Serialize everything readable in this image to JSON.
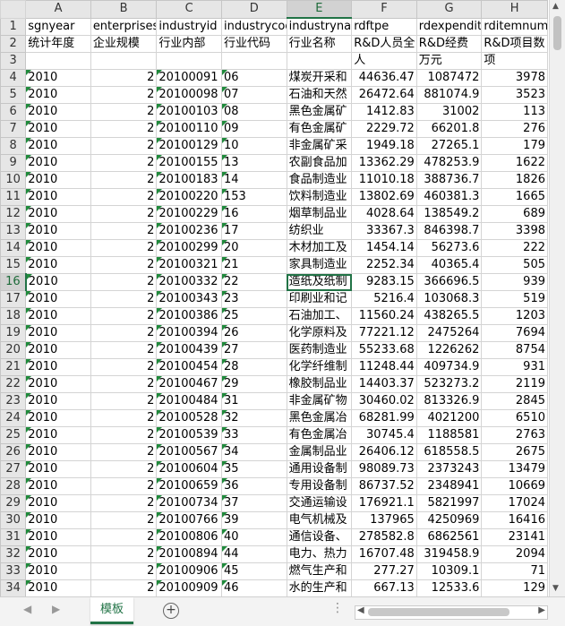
{
  "sheet": {
    "columns": [
      "A",
      "B",
      "C",
      "D",
      "E",
      "F",
      "G",
      "H"
    ],
    "selected_column": "E",
    "selected_row": 16,
    "active_cell": "E16",
    "header_row1": [
      "sgnyear",
      "enterprises",
      "industryid",
      "industrycode",
      "industryname",
      "rdftpe",
      "rdexpenditure",
      "rditemnum"
    ],
    "header_row2": [
      "统计年度",
      "企业规模",
      "行业内部",
      "行业代码",
      "行业名称",
      "R&D人员全",
      "R&D经费",
      "R&D项目数"
    ],
    "header_row3": [
      "",
      "",
      "",
      "",
      "",
      "人",
      "万元",
      "项"
    ],
    "rows": [
      [
        "2010",
        "2",
        "20100091",
        "06",
        "煤炭开采和",
        "44636.47",
        "1087472",
        "3978"
      ],
      [
        "2010",
        "2",
        "20100098",
        "07",
        "石油和天然",
        "26472.64",
        "881074.9",
        "3523"
      ],
      [
        "2010",
        "2",
        "20100103",
        "08",
        "黑色金属矿",
        "1412.83",
        "31002",
        "113"
      ],
      [
        "2010",
        "2",
        "20100110",
        "09",
        "有色金属矿",
        "2229.72",
        "66201.8",
        "276"
      ],
      [
        "2010",
        "2",
        "20100129",
        "10",
        "非金属矿采",
        "1949.18",
        "27265.1",
        "179"
      ],
      [
        "2010",
        "2",
        "20100155",
        "13",
        "农副食品加",
        "13362.29",
        "478253.9",
        "1622"
      ],
      [
        "2010",
        "2",
        "20100183",
        "14",
        "食品制造业",
        "11010.18",
        "388736.7",
        "1826"
      ],
      [
        "2010",
        "2",
        "20100220",
        "153",
        "饮料制造业",
        "13802.69",
        "460381.3",
        "1665"
      ],
      [
        "2010",
        "2",
        "20100229",
        "16",
        "烟草制品业",
        "4028.64",
        "138549.2",
        "689"
      ],
      [
        "2010",
        "2",
        "20100236",
        "17",
        "纺织业",
        "33367.3",
        "846398.7",
        "3398"
      ],
      [
        "2010",
        "2",
        "20100299",
        "20",
        "木材加工及",
        "1454.14",
        "56273.6",
        "222"
      ],
      [
        "2010",
        "2",
        "20100321",
        "21",
        "家具制造业",
        "2252.34",
        "40365.4",
        "505"
      ],
      [
        "2010",
        "2",
        "20100332",
        "22",
        "造纸及纸制",
        "9283.15",
        "366696.5",
        "939"
      ],
      [
        "2010",
        "2",
        "20100343",
        "23",
        "印刷业和记",
        "5216.4",
        "103068.3",
        "519"
      ],
      [
        "2010",
        "2",
        "20100386",
        "25",
        "石油加工、",
        "11560.24",
        "438265.5",
        "1203"
      ],
      [
        "2010",
        "2",
        "20100394",
        "26",
        "化学原料及",
        "77221.12",
        "2475264",
        "7694"
      ],
      [
        "2010",
        "2",
        "20100439",
        "27",
        "医药制造业",
        "55233.68",
        "1226262",
        "8754"
      ],
      [
        "2010",
        "2",
        "20100454",
        "28",
        "化学纤维制",
        "11248.44",
        "409734.9",
        "931"
      ],
      [
        "2010",
        "2",
        "20100467",
        "29",
        "橡胶制品业",
        "14403.37",
        "523273.2",
        "2119"
      ],
      [
        "2010",
        "2",
        "20100484",
        "31",
        "非金属矿物",
        "30460.02",
        "813326.9",
        "2845"
      ],
      [
        "2010",
        "2",
        "20100528",
        "32",
        "黑色金属冶",
        "68281.99",
        "4021200",
        "6510"
      ],
      [
        "2010",
        "2",
        "20100539",
        "33",
        "有色金属冶",
        "30745.4",
        "1188581",
        "2763"
      ],
      [
        "2010",
        "2",
        "20100567",
        "34",
        "金属制品业",
        "26406.12",
        "618558.5",
        "2675"
      ],
      [
        "2010",
        "2",
        "20100604",
        "35",
        "通用设备制",
        "98089.73",
        "2373243",
        "13479"
      ],
      [
        "2010",
        "2",
        "20100659",
        "36",
        "专用设备制",
        "86737.52",
        "2348941",
        "10669"
      ],
      [
        "2010",
        "2",
        "20100734",
        "37",
        "交通运输设",
        "176921.1",
        "5821997",
        "17024"
      ],
      [
        "2010",
        "2",
        "20100766",
        "39",
        "电气机械及",
        "137965",
        "4250969",
        "16416"
      ],
      [
        "2010",
        "2",
        "20100806",
        "40",
        "通信设备、",
        "278582.8",
        "6862561",
        "23141"
      ],
      [
        "2010",
        "2",
        "20100894",
        "44",
        "电力、热力",
        "16707.48",
        "319458.9",
        "2094"
      ],
      [
        "2010",
        "2",
        "20100906",
        "45",
        "燃气生产和",
        "277.27",
        "10309.1",
        "71"
      ],
      [
        "2010",
        "2",
        "20100909",
        "46",
        "水的生产和",
        "667.13",
        "12533.6",
        "129"
      ]
    ]
  },
  "tabs": {
    "active_label": "模板",
    "add_symbol": "+",
    "overflow": "⋮"
  },
  "colors": {
    "accent": "#217346",
    "header_bg": "#e6e6e6",
    "triangle": "#1f8a3b"
  }
}
